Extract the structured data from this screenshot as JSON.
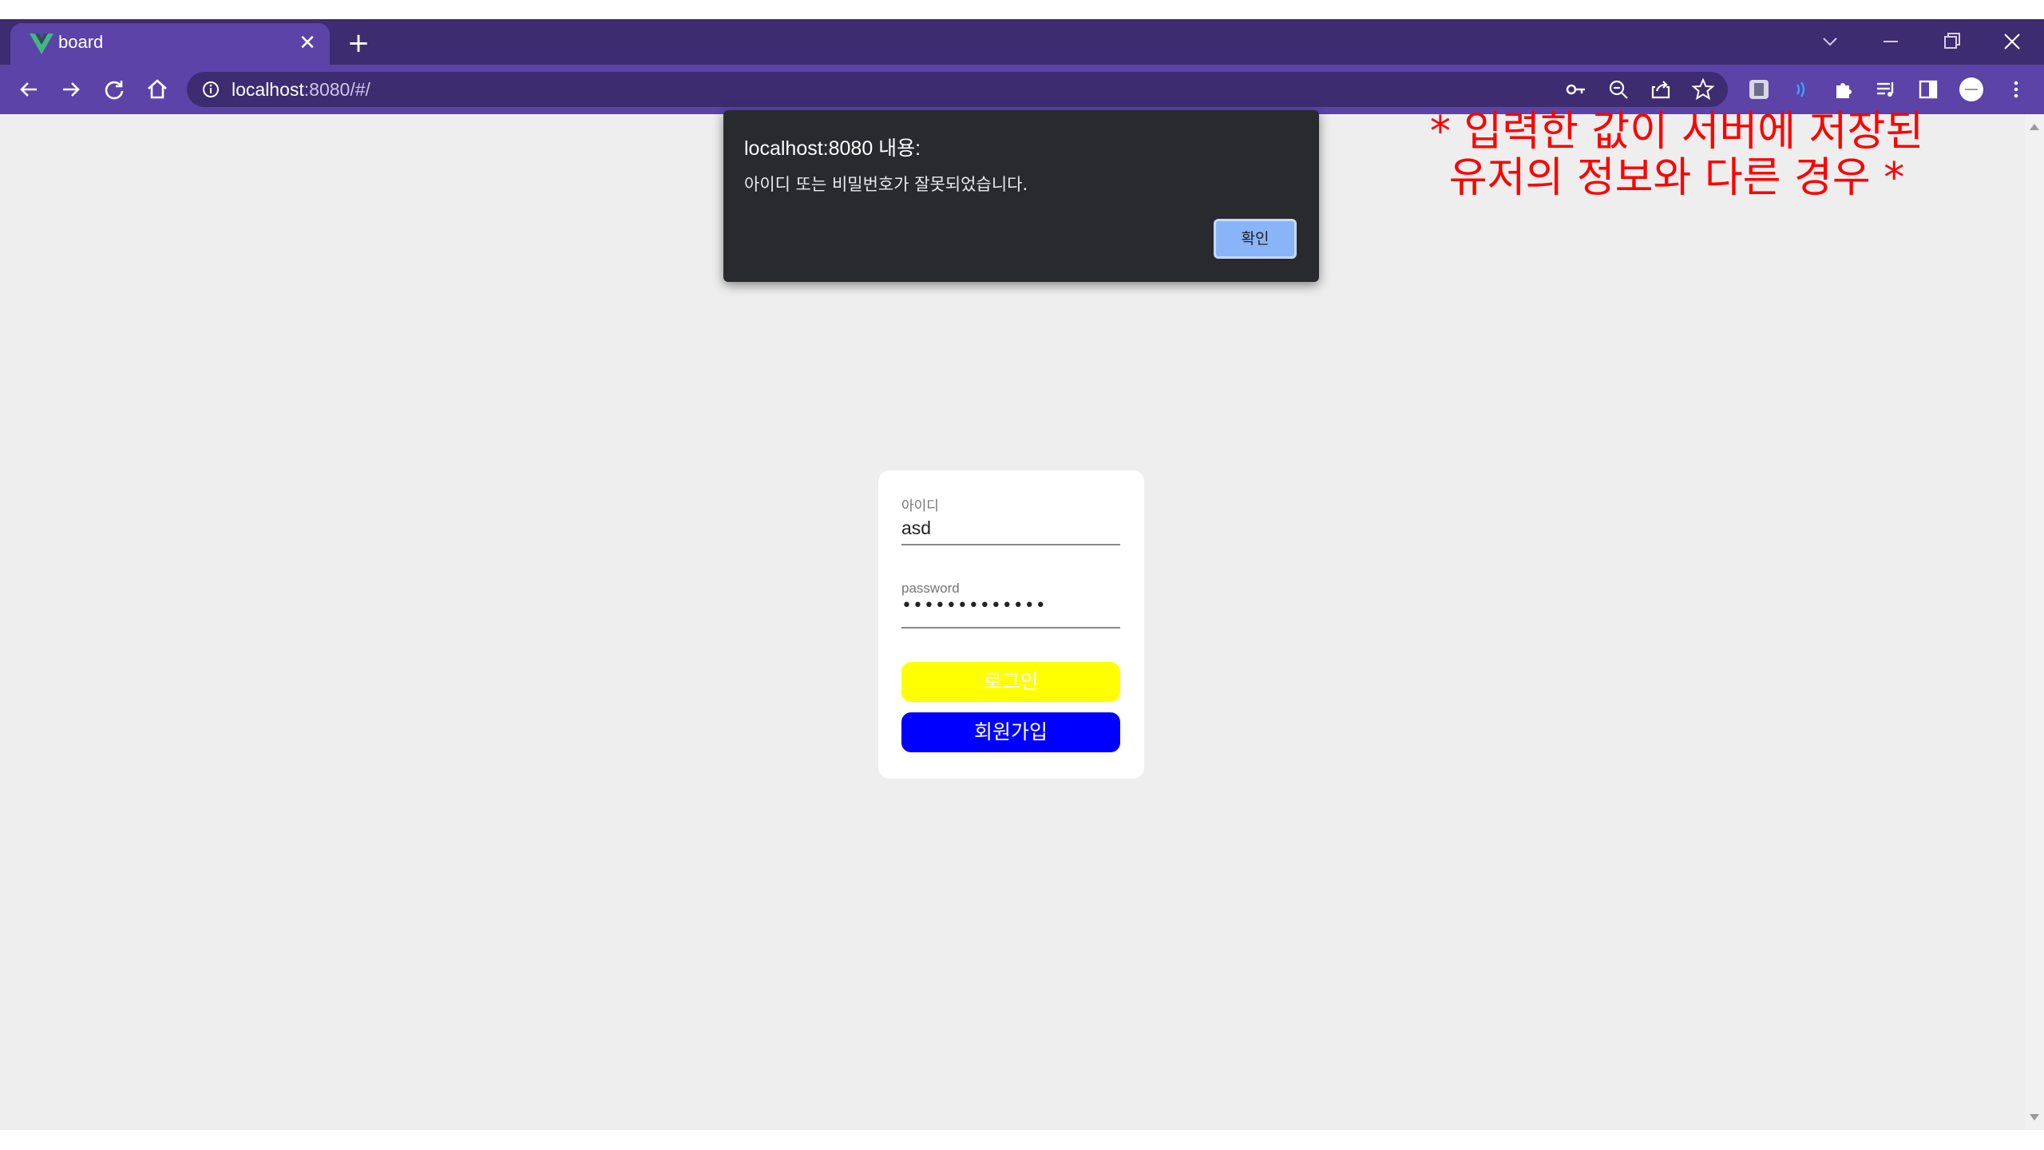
{
  "browser": {
    "tab_title": "board",
    "tab_close": "✕",
    "new_tab": "+",
    "url_host": "localhost",
    "url_rest": ":8080/#/",
    "accent_colors": {
      "titlebar": "#3d2c70",
      "toolbar": "#5b43a8",
      "vue_logo": "#41b883"
    }
  },
  "page": {
    "annotation": "* 입력한 값이 서버에 저장된 유저의 정보와 다른 경우 *",
    "annotation_color": "#ff0000",
    "login": {
      "id_label": "아이디",
      "id_value": "asd",
      "password_label": "password",
      "password_value": "•••••••••••••",
      "login_button": "로그인",
      "login_button_color": "#ffff00",
      "signup_button": "회원가입",
      "signup_button_color": "#0000ff"
    }
  },
  "dialog": {
    "title": "localhost:8080 내용:",
    "message": "아이디 또는 비밀번호가 잘못되었습니다.",
    "ok_button": "확인"
  }
}
